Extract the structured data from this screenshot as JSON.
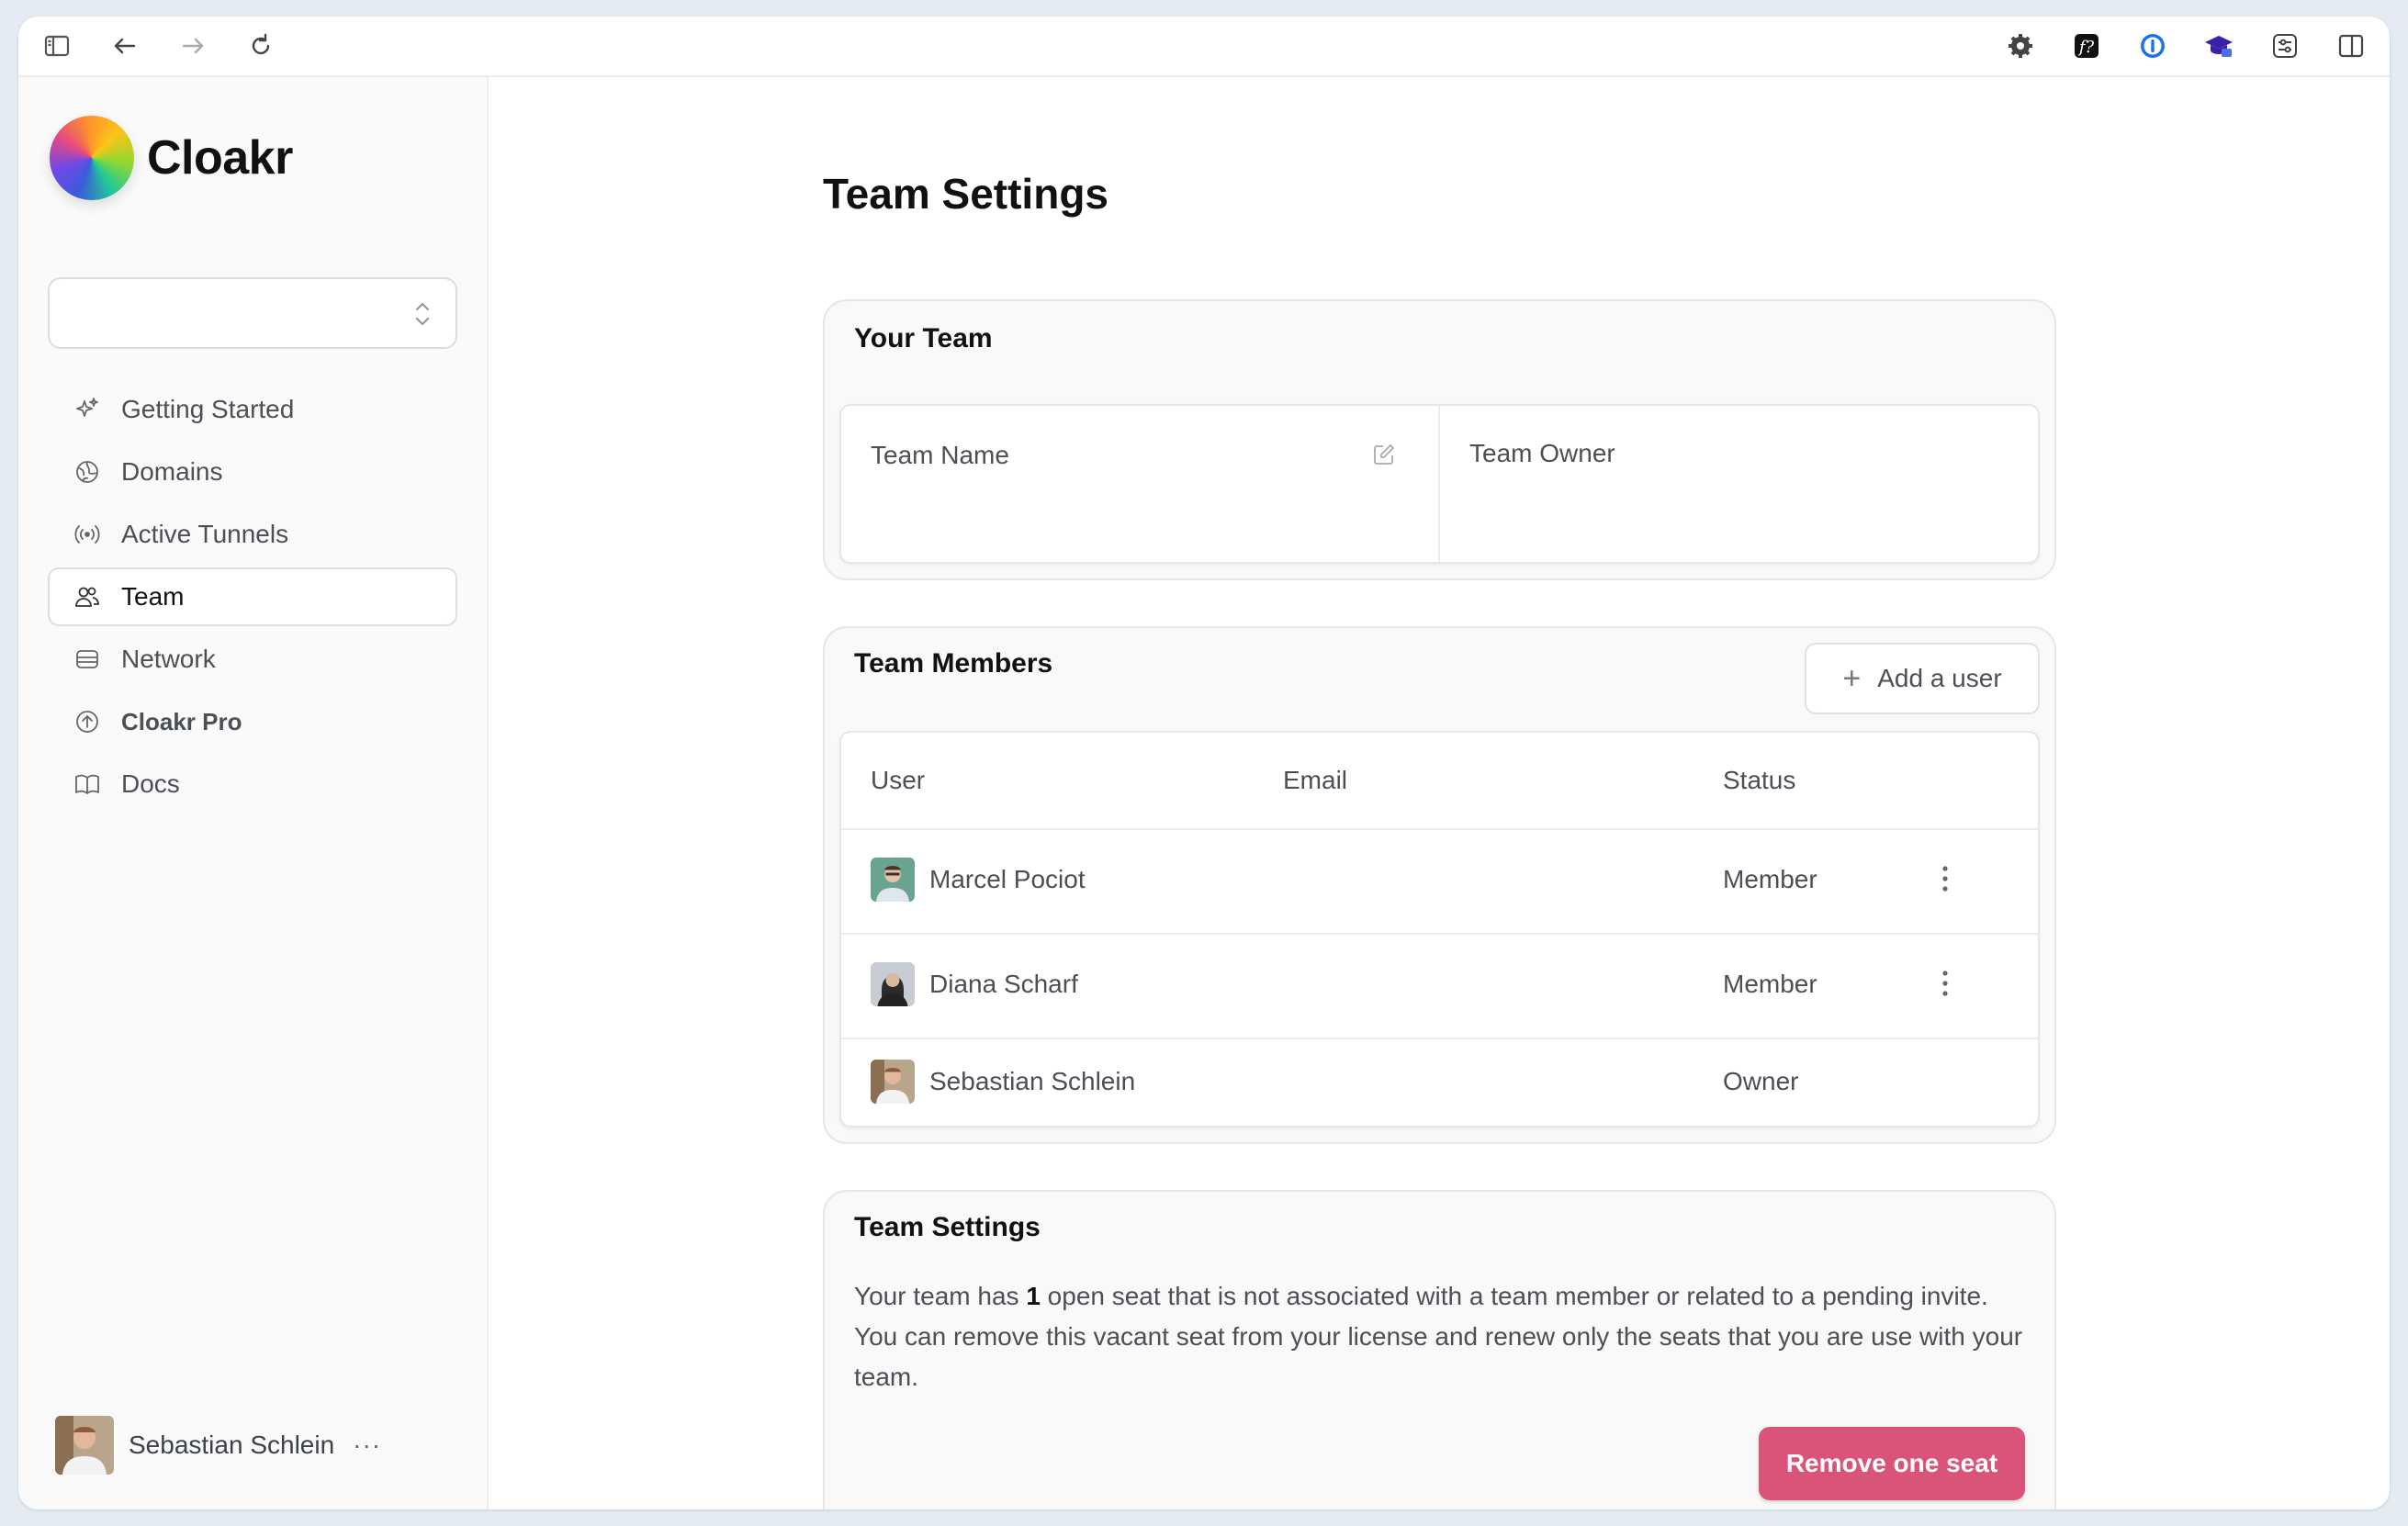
{
  "browser": {
    "icons": [
      "sidebar-toggle-icon",
      "back-arrow-icon",
      "forward-arrow-icon",
      "reload-icon",
      "gear-extension-icon",
      "function-extension-icon",
      "password-manager-icon",
      "graduation-cap-icon",
      "sliders-extension-icon",
      "split-view-icon"
    ]
  },
  "sidebar": {
    "brand": "Cloakr",
    "team_select_value": "",
    "nav": [
      {
        "label": "Getting Started",
        "icon": "sparkles-icon"
      },
      {
        "label": "Domains",
        "icon": "globe-icon"
      },
      {
        "label": "Active Tunnels",
        "icon": "broadcast-icon"
      },
      {
        "label": "Team",
        "icon": "users-icon",
        "active": true
      },
      {
        "label": "Network",
        "icon": "server-icon"
      },
      {
        "label": "Cloakr Pro",
        "icon": "arrow-up-circle-icon"
      },
      {
        "label": "Docs",
        "icon": "book-icon"
      }
    ],
    "user": {
      "name": "Sebastian Schlein",
      "more": "···"
    }
  },
  "main": {
    "title": "Team Settings",
    "your_team": {
      "title": "Your Team",
      "team_name_label": "Team Name",
      "team_owner_label": "Team Owner"
    },
    "members": {
      "title": "Team Members",
      "add_user_label": "Add a user",
      "columns": [
        "User",
        "Email",
        "Status"
      ],
      "rows": [
        {
          "name": "Marcel Pociot",
          "email": "",
          "status": "Member"
        },
        {
          "name": "Diana Scharf",
          "email": "",
          "status": "Member"
        },
        {
          "name": "Sebastian Schlein",
          "email": "",
          "status": "Owner"
        }
      ]
    },
    "settings": {
      "title": "Team Settings",
      "desc_pre": "Your team has ",
      "desc_count": "1",
      "desc_post": " open seat that is not associated with a team member or related to a pending invite. You can remove this vacant seat from your license and renew only the seats that you are use with your team.",
      "remove_label": "Remove one seat"
    }
  },
  "colors": {
    "accent": "#d95478",
    "sidebar_bg": "#fafafa",
    "card_bg": "#f9f9f9"
  }
}
